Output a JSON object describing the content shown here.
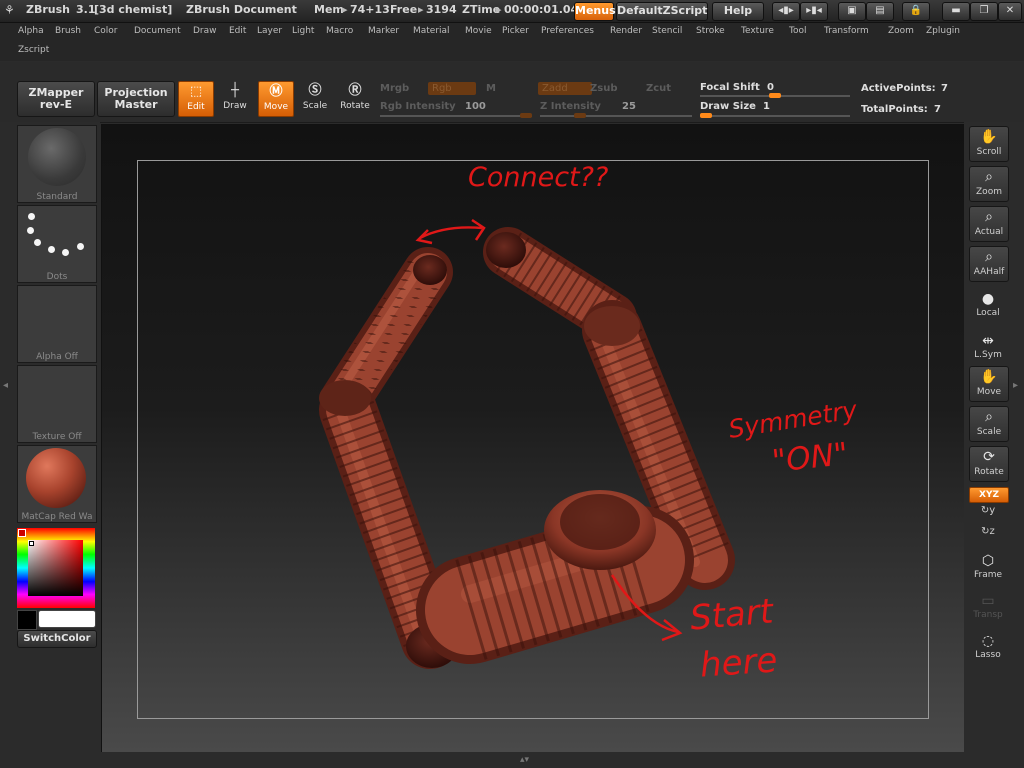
{
  "titlebar": {
    "app_name": "ZBrush",
    "version": "3.1",
    "project": "[3d chemist]",
    "document": "ZBrush Document",
    "mem_label": "Mem",
    "mem_value": "74+13",
    "free_label": "Free",
    "free_value": "3194",
    "ztime_label": "ZTime",
    "ztime_value": "00:00:01.04",
    "menus_button": "Menus",
    "zscript_button": "DefaultZScript",
    "help_button": "Help"
  },
  "menu": {
    "row1": [
      "Alpha",
      "Brush",
      "Color",
      "Document",
      "Draw",
      "Edit",
      "Layer",
      "Light",
      "Macro",
      "Marker",
      "Material",
      "Movie",
      "Picker",
      "Preferences",
      "Render",
      "Stencil",
      "Stroke",
      "Texture",
      "Tool",
      "Transform",
      "Zoom",
      "Zplugin"
    ],
    "row2": [
      "Zscript"
    ]
  },
  "toolbar": {
    "zmapper_line1": "ZMapper",
    "zmapper_line2": "rev-E",
    "projection_line1": "Projection",
    "projection_line2": "Master",
    "edit_label": "Edit",
    "draw_label": "Draw",
    "move_label": "Move",
    "scale_label": "Scale",
    "rotate_label": "Rotate",
    "mrgb": "Mrgb",
    "rgb": "Rgb",
    "m": "M",
    "rgb_intensity_label": "Rgb Intensity",
    "rgb_intensity_value": "100",
    "zadd": "Zadd",
    "zsub": "Zsub",
    "zcut": "Zcut",
    "z_intensity_label": "Z Intensity",
    "z_intensity_value": "25",
    "focal_shift_label": "Focal Shift",
    "focal_shift_value": "0",
    "draw_size_label": "Draw Size",
    "draw_size_value": "1",
    "active_points_label": "ActivePoints:",
    "active_points_value": "7",
    "total_points_label": "TotalPoints:",
    "total_points_value": "7"
  },
  "left_shelf": {
    "brush_label": "Standard",
    "stroke_label": "Dots",
    "alpha_label": "Alpha  Off",
    "texture_label": "Texture  Off",
    "material_label": "MatCap  Red  Wa",
    "switch_color": "SwitchColor"
  },
  "right_shelf": {
    "items": [
      "Scroll",
      "Zoom",
      "Actual",
      "AAHalf",
      "Local",
      "L.Sym",
      "Move",
      "Scale",
      "Rotate",
      "XYZ",
      "Frame",
      "Transp",
      "Lasso"
    ]
  },
  "annotations": {
    "connect": "Connect??",
    "symmetry_line1": "Symmetry",
    "symmetry_line2": "\"ON\"",
    "start_line1": "Start",
    "start_line2": "here"
  },
  "colors": {
    "accent_orange": "#f07a12",
    "model_red": "#8e3a2a",
    "annotation_red": "#e01818",
    "primary_color": "#000000",
    "secondary_color": "#ffffff"
  }
}
